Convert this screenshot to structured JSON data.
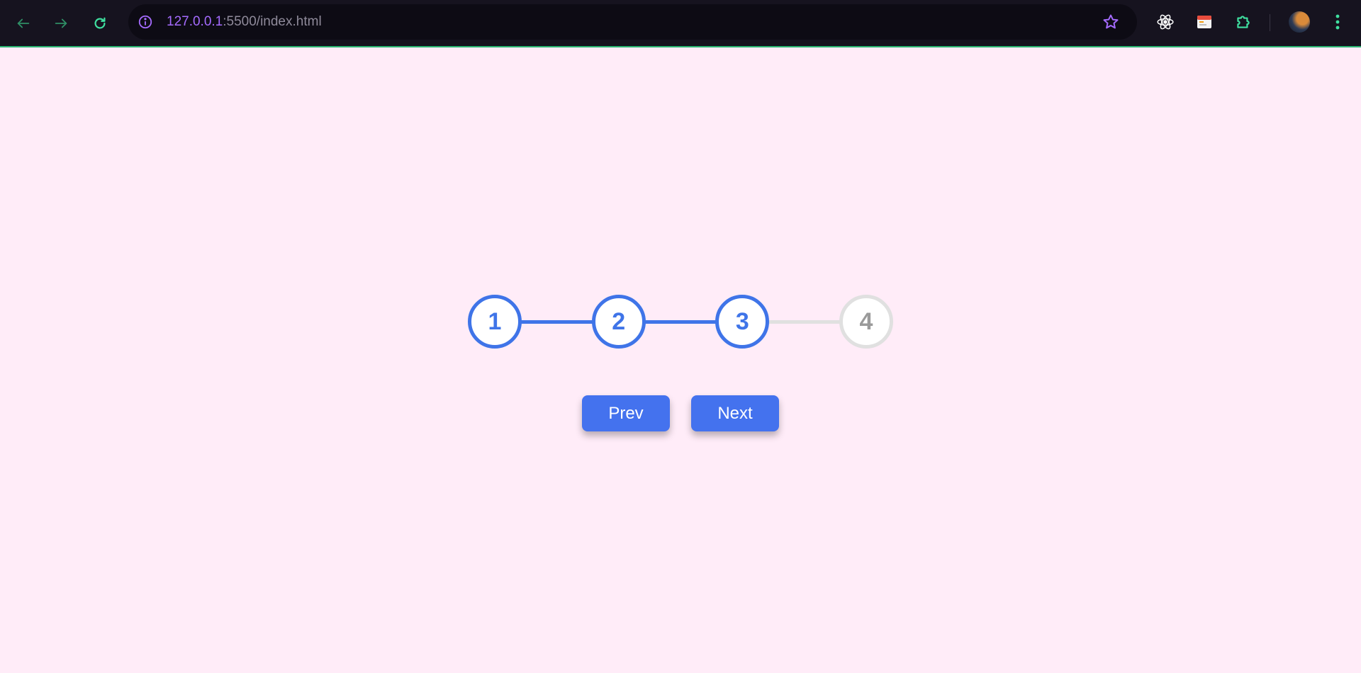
{
  "browser": {
    "url_host": "127.0.0.1",
    "url_rest": ":5500/index.html",
    "colors": {
      "toolbar_bg": "#16131f",
      "accent_green": "#2bb673",
      "url_host": "#a56bff"
    },
    "icons": [
      "back-arrow-icon",
      "forward-arrow-icon",
      "reload-icon",
      "info-icon",
      "star-icon",
      "react-devtools-icon",
      "calendar-extension-icon",
      "extensions-puzzle-icon",
      "profile-avatar",
      "kebab-menu-icon"
    ]
  },
  "page": {
    "background": "#ffecf8"
  },
  "progress": {
    "active_step": 3,
    "total_steps": 4,
    "active_color": "#3f74e8",
    "inactive_color": "#e0e0e0",
    "steps": [
      {
        "label": "1",
        "active": true
      },
      {
        "label": "2",
        "active": true
      },
      {
        "label": "3",
        "active": true
      },
      {
        "label": "4",
        "active": false
      }
    ]
  },
  "buttons": {
    "prev_label": "Prev",
    "next_label": "Next",
    "color": "#4472ee"
  }
}
